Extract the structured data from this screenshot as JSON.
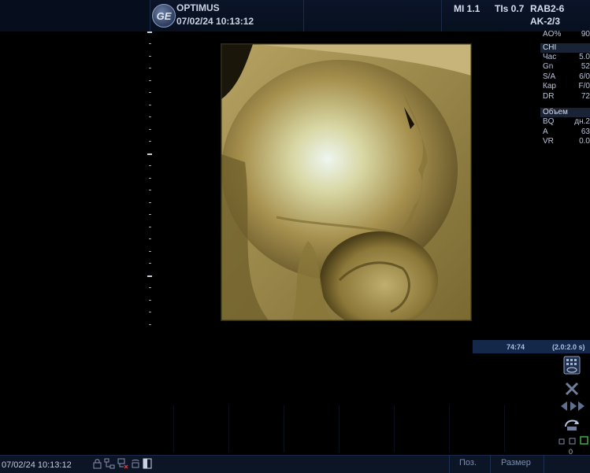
{
  "header": {
    "brand": "OPTIMUS",
    "datetime": "07/02/24 10:13:12",
    "logo_text": "GE",
    "mi": "MI 1.1",
    "tis": "TIs 0.7",
    "probe": "RAB2-6",
    "preset": "AK-2/3"
  },
  "params": {
    "ao_label": "AO%",
    "ao_value": "90",
    "chi": {
      "header": "CHI",
      "rows": [
        {
          "k": "Час",
          "v": "5.0"
        },
        {
          "k": "Gn",
          "v": "52"
        },
        {
          "k": "S/A",
          "v": "6/0"
        },
        {
          "k": "Кар",
          "v": "F/0"
        },
        {
          "k": "DR",
          "v": "72"
        }
      ]
    },
    "volume": {
      "header": "Объем",
      "rows": [
        {
          "k": "BQ",
          "v": "дн.2"
        },
        {
          "k": "A",
          "v": "63"
        },
        {
          "k": "VR",
          "v": "0.0"
        }
      ]
    }
  },
  "cine": {
    "frames": "74:74",
    "time": "(2.0:2.0 s)"
  },
  "status": {
    "zero": "0"
  },
  "footer": {
    "date": "07/02/24 10:13:12",
    "pos_label": "Поз.",
    "size_label": "Размер"
  },
  "colors": {
    "background": "#000000",
    "accent_blue": "#14284a",
    "render_sepia": "#c9b068"
  },
  "image": {
    "description_icon": "3d-ultrasound-render"
  }
}
